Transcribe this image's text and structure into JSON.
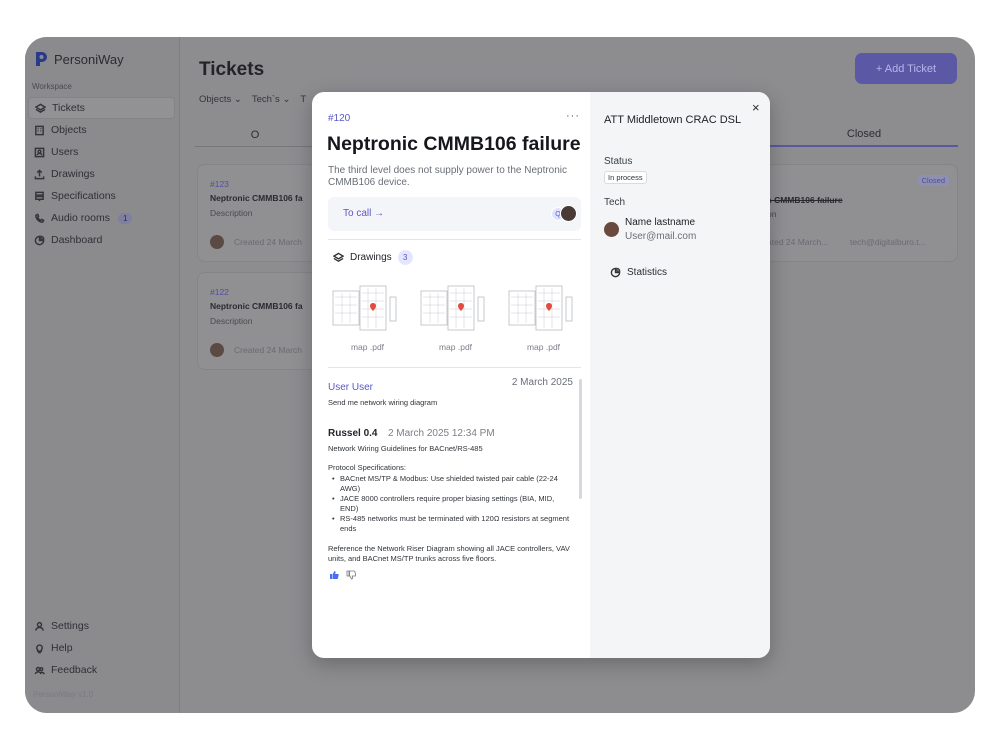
{
  "app": {
    "name": "PersoniWay",
    "workspace_label": "Workspace",
    "version": "PersoniWay v1.0"
  },
  "sidebar": {
    "items": [
      {
        "label": "Tickets",
        "icon": "layers-icon",
        "active": true
      },
      {
        "label": "Objects",
        "icon": "building-icon"
      },
      {
        "label": "Users",
        "icon": "user-card-icon"
      },
      {
        "label": "Drawings",
        "icon": "upload-icon"
      },
      {
        "label": "Specifications",
        "icon": "database-icon"
      },
      {
        "label": "Audio rooms",
        "icon": "phone-icon",
        "badge": "1"
      },
      {
        "label": "Dashboard",
        "icon": "pie-chart-icon"
      }
    ],
    "bottom": [
      {
        "label": "Settings",
        "icon": "person-icon"
      },
      {
        "label": "Help",
        "icon": "lightbulb-icon"
      },
      {
        "label": "Feedback",
        "icon": "people-icon"
      }
    ]
  },
  "page": {
    "title": "Tickets",
    "filters": [
      "Objects",
      "Tech`s",
      "T"
    ],
    "add_button": "+ Add Ticket",
    "columns": {
      "left": "O",
      "right": "Closed"
    }
  },
  "background_cards": [
    {
      "id": "#123",
      "title": "Neptronic CMMB106 fa",
      "description": "Description",
      "meta": "Created 24 March"
    },
    {
      "id": "#122",
      "title": "Neptronic CMMB106 fa",
      "description": "Description",
      "meta": "Created 24 March"
    }
  ],
  "closed_card": {
    "status": "Closed",
    "title": "s CMMB106 failure",
    "description": "on",
    "meta": "ated 24 March...",
    "email": "tech@digitalburo.t..."
  },
  "ticket": {
    "id": "#120",
    "title": "Neptronic CMMB106 failure",
    "description": "The third level does not supply power to the Neptronic CMMB106 device.",
    "call_label": "To call →",
    "caller_initials": "Q",
    "drawings_label": "Drawings",
    "drawings_count": "3",
    "drawings": [
      {
        "label": "map .pdf"
      },
      {
        "label": "map .pdf"
      },
      {
        "label": "map .pdf"
      }
    ]
  },
  "comments": {
    "first": {
      "author": "User User",
      "date": "2 March 2025",
      "text": "Send me network wiring diagram"
    },
    "second": {
      "author": "Russel 0.4",
      "date": "2 March 2025 12:34 PM",
      "heading": "Network Wiring Guidelines for BACnet/RS-485",
      "spec_title": "Protocol Specifications:",
      "bullets": [
        "BACnet MS/TP & Modbus: Use shielded twisted pair cable (22-24 AWG)",
        "JACE 8000 controllers require proper biasing settings (BIA, MID, END)",
        "RS-485 networks must be terminated with 120Ω resistors at segment ends"
      ],
      "footer": "Reference the Network Riser Diagram showing all JACE controllers, VAV units, and BACnet MS/TP trunks across five floors."
    }
  },
  "details": {
    "object": "ATT Middletown CRAC DSL",
    "status_label": "Status",
    "status_value": "In process",
    "tech_label": "Tech",
    "tech_name": "Name lastname",
    "tech_email": "User@mail.com",
    "statistics_label": "Statistics",
    "close": "×"
  },
  "colors": {
    "accent": "#5a58c8",
    "overlay": "#8d8d90"
  }
}
